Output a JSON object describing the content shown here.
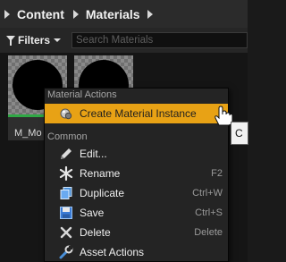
{
  "breadcrumb": {
    "items": [
      "Content",
      "Materials"
    ]
  },
  "toolbar": {
    "filters_label": "Filters",
    "search_placeholder": "Search Materials"
  },
  "assets": [
    {
      "label": "M_Mo"
    },
    {
      "label": ""
    }
  ],
  "context_menu": {
    "sections": [
      {
        "heading": "Material Actions",
        "items": [
          {
            "label": "Create Material Instance",
            "icon": "material-instance-icon",
            "highlighted": true
          }
        ]
      },
      {
        "heading": "Common",
        "items": [
          {
            "label": "Edit...",
            "icon": "pencil-icon",
            "shortcut": ""
          },
          {
            "label": "Rename",
            "icon": "rename-icon",
            "shortcut": "F2"
          },
          {
            "label": "Duplicate",
            "icon": "duplicate-icon",
            "shortcut": "Ctrl+W"
          },
          {
            "label": "Save",
            "icon": "save-icon",
            "shortcut": "Ctrl+S"
          },
          {
            "label": "Delete",
            "icon": "delete-icon",
            "shortcut": "Delete"
          },
          {
            "label": "Asset Actions",
            "icon": "wrench-icon",
            "shortcut": ""
          }
        ]
      }
    ]
  },
  "tooltip": {
    "text": "C"
  },
  "colors": {
    "highlight": "#e8a215",
    "asset_type_bar": "#2fa845"
  }
}
